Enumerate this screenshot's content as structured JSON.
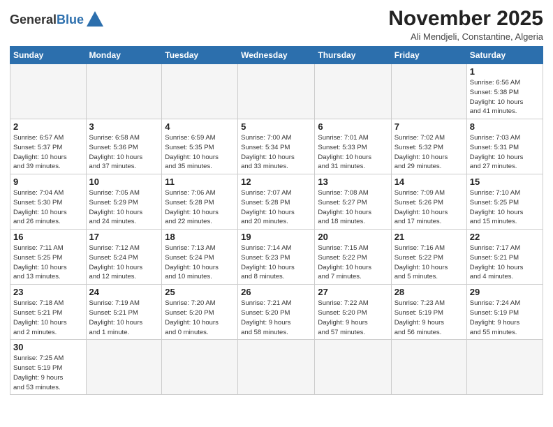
{
  "logo": {
    "text_general": "General",
    "text_blue": "Blue"
  },
  "header": {
    "title": "November 2025",
    "subtitle": "Ali Mendjeli, Constantine, Algeria"
  },
  "weekdays": [
    "Sunday",
    "Monday",
    "Tuesday",
    "Wednesday",
    "Thursday",
    "Friday",
    "Saturday"
  ],
  "days": [
    {
      "num": "",
      "info": ""
    },
    {
      "num": "",
      "info": ""
    },
    {
      "num": "",
      "info": ""
    },
    {
      "num": "",
      "info": ""
    },
    {
      "num": "",
      "info": ""
    },
    {
      "num": "",
      "info": ""
    },
    {
      "num": "1",
      "info": "Sunrise: 6:56 AM\nSunset: 5:38 PM\nDaylight: 10 hours\nand 41 minutes."
    },
    {
      "num": "2",
      "info": "Sunrise: 6:57 AM\nSunset: 5:37 PM\nDaylight: 10 hours\nand 39 minutes."
    },
    {
      "num": "3",
      "info": "Sunrise: 6:58 AM\nSunset: 5:36 PM\nDaylight: 10 hours\nand 37 minutes."
    },
    {
      "num": "4",
      "info": "Sunrise: 6:59 AM\nSunset: 5:35 PM\nDaylight: 10 hours\nand 35 minutes."
    },
    {
      "num": "5",
      "info": "Sunrise: 7:00 AM\nSunset: 5:34 PM\nDaylight: 10 hours\nand 33 minutes."
    },
    {
      "num": "6",
      "info": "Sunrise: 7:01 AM\nSunset: 5:33 PM\nDaylight: 10 hours\nand 31 minutes."
    },
    {
      "num": "7",
      "info": "Sunrise: 7:02 AM\nSunset: 5:32 PM\nDaylight: 10 hours\nand 29 minutes."
    },
    {
      "num": "8",
      "info": "Sunrise: 7:03 AM\nSunset: 5:31 PM\nDaylight: 10 hours\nand 27 minutes."
    },
    {
      "num": "9",
      "info": "Sunrise: 7:04 AM\nSunset: 5:30 PM\nDaylight: 10 hours\nand 26 minutes."
    },
    {
      "num": "10",
      "info": "Sunrise: 7:05 AM\nSunset: 5:29 PM\nDaylight: 10 hours\nand 24 minutes."
    },
    {
      "num": "11",
      "info": "Sunrise: 7:06 AM\nSunset: 5:28 PM\nDaylight: 10 hours\nand 22 minutes."
    },
    {
      "num": "12",
      "info": "Sunrise: 7:07 AM\nSunset: 5:28 PM\nDaylight: 10 hours\nand 20 minutes."
    },
    {
      "num": "13",
      "info": "Sunrise: 7:08 AM\nSunset: 5:27 PM\nDaylight: 10 hours\nand 18 minutes."
    },
    {
      "num": "14",
      "info": "Sunrise: 7:09 AM\nSunset: 5:26 PM\nDaylight: 10 hours\nand 17 minutes."
    },
    {
      "num": "15",
      "info": "Sunrise: 7:10 AM\nSunset: 5:25 PM\nDaylight: 10 hours\nand 15 minutes."
    },
    {
      "num": "16",
      "info": "Sunrise: 7:11 AM\nSunset: 5:25 PM\nDaylight: 10 hours\nand 13 minutes."
    },
    {
      "num": "17",
      "info": "Sunrise: 7:12 AM\nSunset: 5:24 PM\nDaylight: 10 hours\nand 12 minutes."
    },
    {
      "num": "18",
      "info": "Sunrise: 7:13 AM\nSunset: 5:24 PM\nDaylight: 10 hours\nand 10 minutes."
    },
    {
      "num": "19",
      "info": "Sunrise: 7:14 AM\nSunset: 5:23 PM\nDaylight: 10 hours\nand 8 minutes."
    },
    {
      "num": "20",
      "info": "Sunrise: 7:15 AM\nSunset: 5:22 PM\nDaylight: 10 hours\nand 7 minutes."
    },
    {
      "num": "21",
      "info": "Sunrise: 7:16 AM\nSunset: 5:22 PM\nDaylight: 10 hours\nand 5 minutes."
    },
    {
      "num": "22",
      "info": "Sunrise: 7:17 AM\nSunset: 5:21 PM\nDaylight: 10 hours\nand 4 minutes."
    },
    {
      "num": "23",
      "info": "Sunrise: 7:18 AM\nSunset: 5:21 PM\nDaylight: 10 hours\nand 2 minutes."
    },
    {
      "num": "24",
      "info": "Sunrise: 7:19 AM\nSunset: 5:21 PM\nDaylight: 10 hours\nand 1 minute."
    },
    {
      "num": "25",
      "info": "Sunrise: 7:20 AM\nSunset: 5:20 PM\nDaylight: 10 hours\nand 0 minutes."
    },
    {
      "num": "26",
      "info": "Sunrise: 7:21 AM\nSunset: 5:20 PM\nDaylight: 9 hours\nand 58 minutes."
    },
    {
      "num": "27",
      "info": "Sunrise: 7:22 AM\nSunset: 5:20 PM\nDaylight: 9 hours\nand 57 minutes."
    },
    {
      "num": "28",
      "info": "Sunrise: 7:23 AM\nSunset: 5:19 PM\nDaylight: 9 hours\nand 56 minutes."
    },
    {
      "num": "29",
      "info": "Sunrise: 7:24 AM\nSunset: 5:19 PM\nDaylight: 9 hours\nand 55 minutes."
    },
    {
      "num": "30",
      "info": "Sunrise: 7:25 AM\nSunset: 5:19 PM\nDaylight: 9 hours\nand 53 minutes."
    },
    {
      "num": "",
      "info": ""
    },
    {
      "num": "",
      "info": ""
    },
    {
      "num": "",
      "info": ""
    },
    {
      "num": "",
      "info": ""
    },
    {
      "num": "",
      "info": ""
    },
    {
      "num": "",
      "info": ""
    }
  ]
}
